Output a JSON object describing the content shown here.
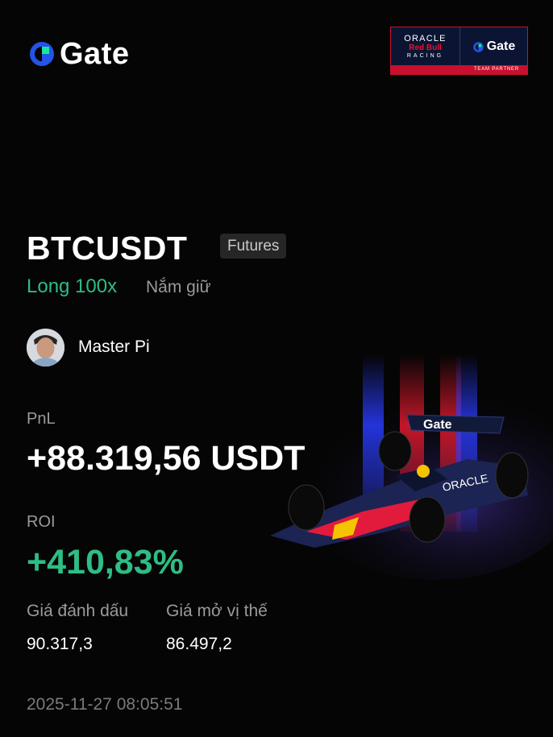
{
  "brand": {
    "name": "Gate",
    "accent_blue": "#2354e6",
    "accent_green": "#17e6a1"
  },
  "partner": {
    "line1": "ORACLE",
    "line2": "Red Bull",
    "line3": "RACING",
    "gate_name": "Gate",
    "footer": "TEAM PARTNER"
  },
  "position": {
    "pair": "BTCUSDT",
    "market_type": "Futures",
    "direction": "Long 100x",
    "status": "Nắm giữ"
  },
  "user": {
    "name": "Master Pi"
  },
  "pnl": {
    "label": "PnL",
    "value": "+88.319,56 USDT"
  },
  "roi": {
    "label": "ROI",
    "value": "+410,83%"
  },
  "prices": {
    "mark_label": "Giá đánh dấu",
    "mark_value": "90.317,3",
    "entry_label": "Giá mở vị thế",
    "entry_value": "86.497,2"
  },
  "timestamp": "2025-11-27 08:05:51",
  "colors": {
    "profit_green": "#2ebd85",
    "muted_text": "#9a9a9a",
    "background": "#050505"
  },
  "icons": [
    "gate-logo-icon",
    "red-bull-f1-car-illustration",
    "user-avatar"
  ]
}
